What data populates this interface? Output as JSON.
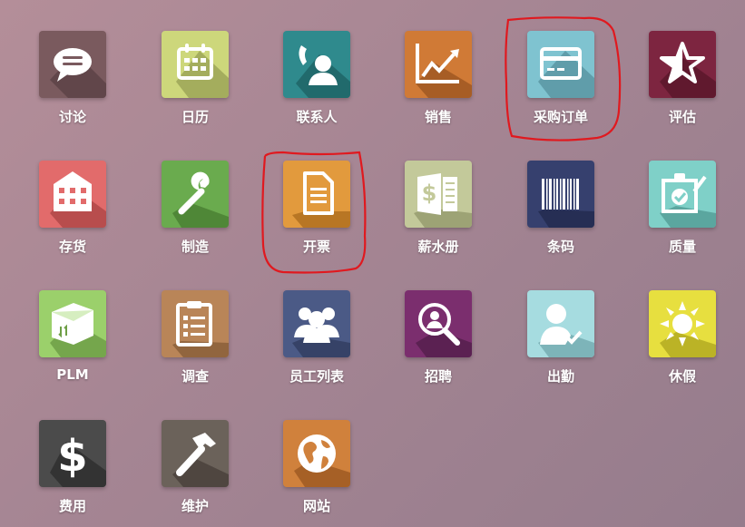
{
  "apps": [
    {
      "id": "discuss",
      "label": "讨论",
      "icon": "chat-bubble-icon",
      "color": "#7a5a5e",
      "dark": "#5d4347"
    },
    {
      "id": "calendar",
      "label": "日历",
      "icon": "calendar-icon",
      "color": "#cdd77b",
      "dark": "#9aa356"
    },
    {
      "id": "contacts",
      "label": "联系人",
      "icon": "contact-phone-icon",
      "color": "#2f8a8d",
      "dark": "#1f6466"
    },
    {
      "id": "sales",
      "label": "销售",
      "icon": "trend-chart-icon",
      "color": "#d07a36",
      "dark": "#a05822"
    },
    {
      "id": "purchase",
      "label": "采购订单",
      "icon": "credit-card-icon",
      "color": "#7fc3d0",
      "dark": "#5a97a3"
    },
    {
      "id": "appraisal",
      "label": "评估",
      "icon": "star-icon",
      "color": "#7d2540",
      "dark": "#5a172c"
    },
    {
      "id": "inventory",
      "label": "存货",
      "icon": "warehouse-icon",
      "color": "#e26b6b",
      "dark": "#b04848"
    },
    {
      "id": "manufacturing",
      "label": "制造",
      "icon": "wrench-icon",
      "color": "#6aab4e",
      "dark": "#4a8034"
    },
    {
      "id": "invoicing",
      "label": "开票",
      "icon": "document-icon",
      "color": "#e29a3d",
      "dark": "#b07020"
    },
    {
      "id": "payroll",
      "label": "薪水册",
      "icon": "ledger-dollar-icon",
      "color": "#c3c99a",
      "dark": "#969c6f"
    },
    {
      "id": "barcode",
      "label": "条码",
      "icon": "barcode-icon",
      "color": "#36406e",
      "dark": "#232b50"
    },
    {
      "id": "quality",
      "label": "质量",
      "icon": "quality-check-icon",
      "color": "#7fd0c8",
      "dark": "#559f98"
    },
    {
      "id": "plm",
      "label": "PLM",
      "icon": "package-box-icon",
      "color": "#9bd06b",
      "dark": "#6e9f46"
    },
    {
      "id": "survey",
      "label": "调查",
      "icon": "clipboard-icon",
      "color": "#b98558",
      "dark": "#8a5f3a"
    },
    {
      "id": "employees",
      "label": "员工列表",
      "icon": "people-group-icon",
      "color": "#4b5a86",
      "dark": "#333e62"
    },
    {
      "id": "recruitment",
      "label": "招聘",
      "icon": "magnifier-person-icon",
      "color": "#7b2e6e",
      "dark": "#561e4d"
    },
    {
      "id": "attendance",
      "label": "出勤",
      "icon": "person-check-icon",
      "color": "#a6dce0",
      "dark": "#76adb1"
    },
    {
      "id": "timeoff",
      "label": "休假",
      "icon": "sun-icon",
      "color": "#e7df3f",
      "dark": "#b3ac22"
    },
    {
      "id": "expenses",
      "label": "费用",
      "icon": "dollar-icon",
      "color": "#4b4b4b",
      "dark": "#2f2f2f"
    },
    {
      "id": "maintenance",
      "label": "维护",
      "icon": "hammer-icon",
      "color": "#6b625a",
      "dark": "#4a423c"
    },
    {
      "id": "website",
      "label": "网站",
      "icon": "globe-icon",
      "color": "#d0813c",
      "dark": "#9f5b22"
    }
  ],
  "annotations": {
    "highlight_color": "#e0191f"
  }
}
